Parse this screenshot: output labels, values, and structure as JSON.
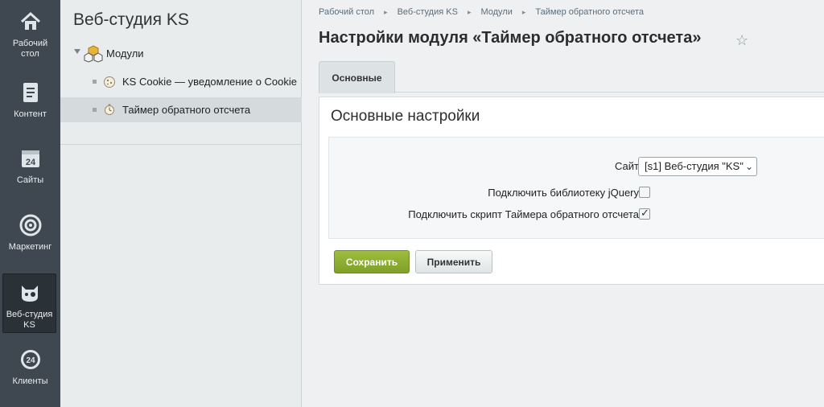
{
  "left_menu": [
    {
      "id": "desktop",
      "label_line1": "Рабочий",
      "label_line2": "стол",
      "icon": "home-icon"
    },
    {
      "id": "content",
      "label_line1": "Контент",
      "label_line2": "",
      "icon": "document-icon"
    },
    {
      "id": "sites",
      "label_line1": "Сайты",
      "label_line2": "",
      "icon": "calendar-24-icon"
    },
    {
      "id": "marketing",
      "label_line1": "Маркетинг",
      "label_line2": "",
      "icon": "target-icon"
    },
    {
      "id": "ks",
      "label_line1": "Веб-студия",
      "label_line2": "KS",
      "icon": "cat-icon",
      "active": true
    },
    {
      "id": "clients",
      "label_line1": "Клиенты",
      "label_line2": "",
      "icon": "b24-icon"
    }
  ],
  "tree": {
    "title": "Веб-студия KS",
    "root_label": "Модули",
    "items": [
      {
        "label": "KS Cookie — уведомление о Cookie",
        "icon": "cookie-icon"
      },
      {
        "label": "Таймер обратного отсчета",
        "icon": "timer-icon",
        "active": true
      }
    ]
  },
  "breadcrumbs": [
    "Рабочий стол",
    "Веб-студия KS",
    "Модули",
    "Таймер обратного отсчета"
  ],
  "page_title": "Настройки модуля «Таймер обратного отсчета»",
  "tabs": [
    {
      "label": "Основные",
      "active": true
    }
  ],
  "section_title": "Основные настройки",
  "form": {
    "site_label": "Сайт",
    "site_value": "[s1] Веб-студия \"KS\"",
    "jquery_label": "Подключить библиотеку jQuery",
    "jquery_checked": false,
    "timer_label": "Подключить скрипт Таймера обратного отсчета",
    "timer_checked": true
  },
  "buttons": {
    "save": "Сохранить",
    "apply": "Применить"
  },
  "colors": {
    "sidebar_bg": "#3f4850",
    "save_button": "#8aad32",
    "page_bg": "#eef0f1"
  }
}
